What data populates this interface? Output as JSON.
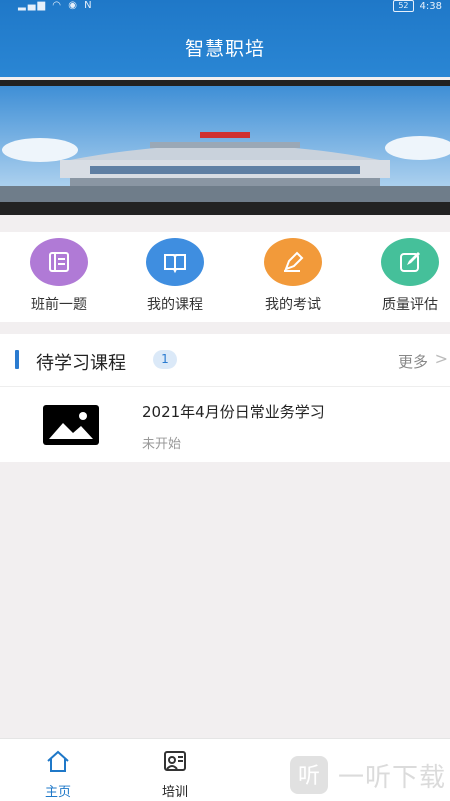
{
  "status_bar": {
    "left_icons": [
      "signal-icon",
      "wifi-icon",
      "eye-icon",
      "nfc-icon"
    ],
    "battery": "52",
    "time": "4:38"
  },
  "header": {
    "title": "智慧职培"
  },
  "banner": {
    "alt": "station-building-image"
  },
  "quick_menu": [
    {
      "label": "班前一题",
      "icon": "ticket-icon",
      "color": "#b07ad6"
    },
    {
      "label": "我的课程",
      "icon": "book-icon",
      "color": "#3f8ee0"
    },
    {
      "label": "我的考试",
      "icon": "pen-icon",
      "color": "#f29a3a"
    },
    {
      "label": "质量评估",
      "icon": "edit-icon",
      "color": "#45c09a"
    }
  ],
  "pending": {
    "title": "待学习课程",
    "count": "1",
    "more": "更多",
    "courses": [
      {
        "title": "2021年4月份日常业务学习",
        "status": "未开始"
      }
    ]
  },
  "bottom_nav": {
    "items": [
      {
        "label": "主页",
        "icon": "home-icon",
        "active": true
      },
      {
        "label": "培训",
        "icon": "training-icon",
        "active": false
      }
    ]
  },
  "watermark": {
    "text": "一听下载",
    "logo": "听"
  },
  "colors": {
    "primary": "#1f78c8",
    "background": "#f2eff0"
  }
}
